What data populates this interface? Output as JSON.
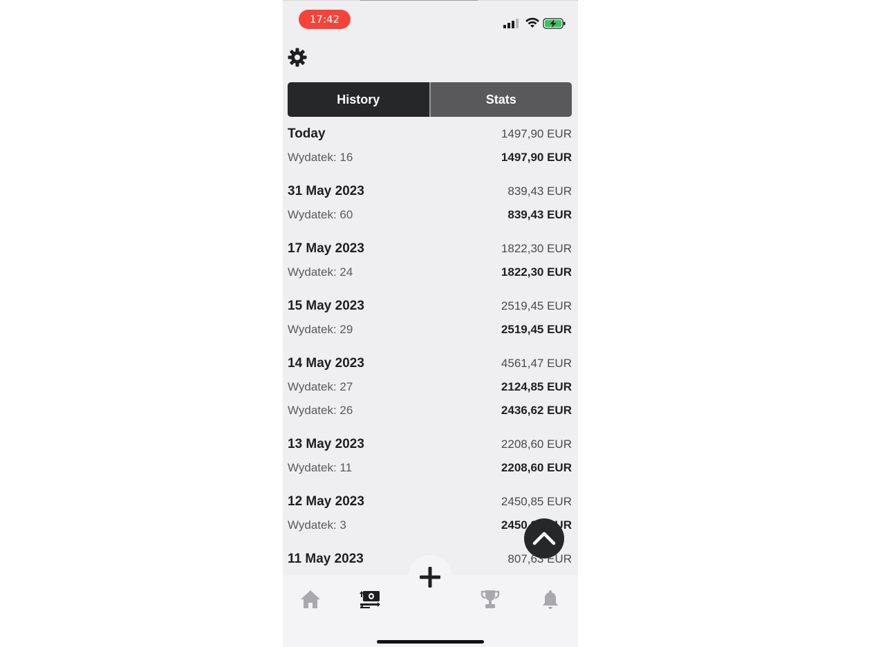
{
  "status_bar": {
    "time": "17:42"
  },
  "header": {
    "settings_icon": "gear-icon"
  },
  "tabs": {
    "history": "History",
    "stats": "Stats",
    "active": "History"
  },
  "groups": [
    {
      "date": "Today",
      "total": "1497,90 EUR",
      "items": [
        {
          "label": "Wydatek: 16",
          "amount": "1497,90 EUR"
        }
      ]
    },
    {
      "date": "31 May 2023",
      "total": "839,43 EUR",
      "items": [
        {
          "label": "Wydatek: 60",
          "amount": "839,43 EUR"
        }
      ]
    },
    {
      "date": "17 May 2023",
      "total": "1822,30 EUR",
      "items": [
        {
          "label": "Wydatek: 24",
          "amount": "1822,30 EUR"
        }
      ]
    },
    {
      "date": "15 May 2023",
      "total": "2519,45 EUR",
      "items": [
        {
          "label": "Wydatek: 29",
          "amount": "2519,45 EUR"
        }
      ]
    },
    {
      "date": "14 May 2023",
      "total": "4561,47 EUR",
      "items": [
        {
          "label": "Wydatek: 27",
          "amount": "2124,85 EUR"
        },
        {
          "label": "Wydatek: 26",
          "amount": "2436,62 EUR"
        }
      ]
    },
    {
      "date": "13 May 2023",
      "total": "2208,60 EUR",
      "items": [
        {
          "label": "Wydatek: 11",
          "amount": "2208,60 EUR"
        }
      ]
    },
    {
      "date": "12 May 2023",
      "total": "2450,85 EUR",
      "items": [
        {
          "label": "Wydatek: 3",
          "amount": "2450,85 EUR"
        }
      ]
    },
    {
      "date": "11 May 2023",
      "total": "807,63 EUR",
      "items": []
    }
  ],
  "tabbar": {
    "items": [
      "home-icon",
      "money-exchange-icon",
      "add-icon",
      "trophy-icon",
      "bell-icon"
    ],
    "active": "money-exchange-icon"
  },
  "colors": {
    "time_pill": "#f5433a",
    "dark": "#262728",
    "background": "#efeff1",
    "battery": "#34c759"
  }
}
